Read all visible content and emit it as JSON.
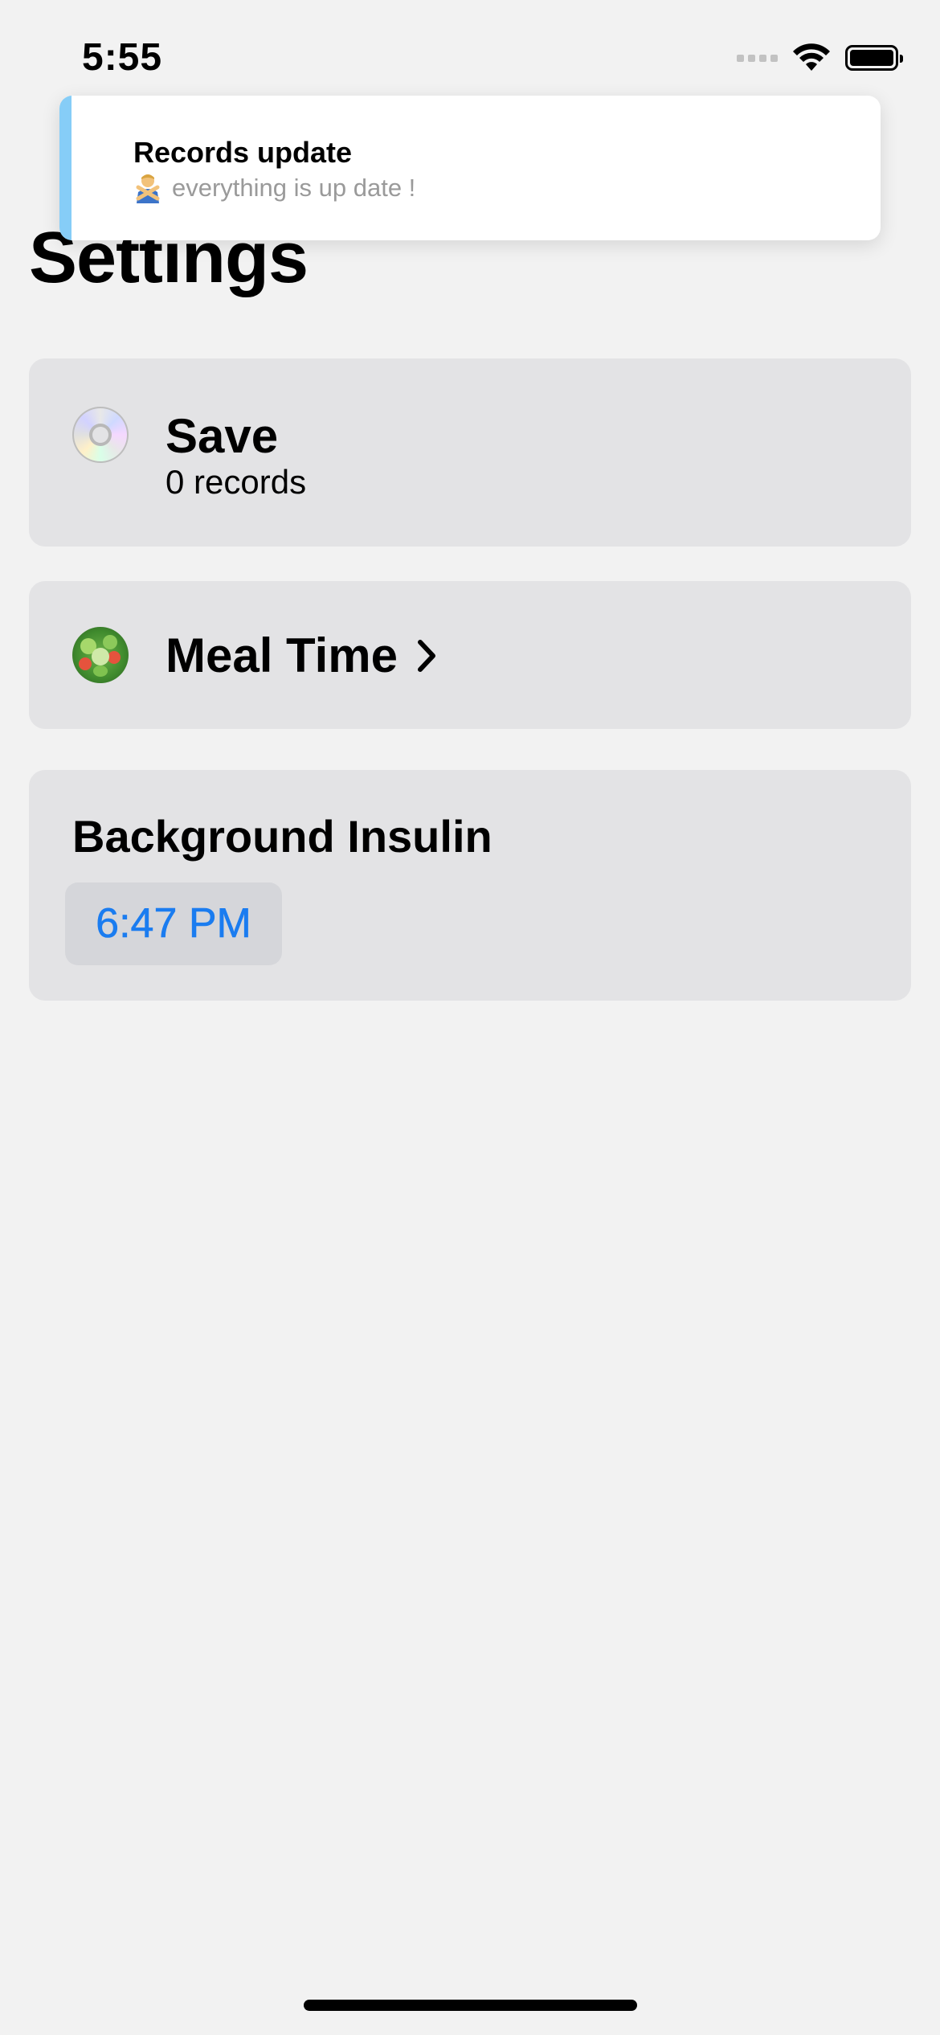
{
  "status_bar": {
    "time": "5:55",
    "icons": [
      "cellular-signal-icon",
      "wifi-icon",
      "battery-icon"
    ]
  },
  "toast": {
    "title": "Records update",
    "emoji_icon": "person-gesturing-no-icon",
    "message": "everything is up date !",
    "accent_color": "#86cdf7"
  },
  "page": {
    "title": "Settings"
  },
  "save_row": {
    "icon": "cd-disc-icon",
    "title": "Save",
    "subtitle": "0 records"
  },
  "meal_row": {
    "icon": "salad-icon",
    "title": "Meal Time"
  },
  "insulin": {
    "title": "Background Insulin",
    "time_value": "6:47 PM",
    "accent_color": "#1a7cf0"
  }
}
